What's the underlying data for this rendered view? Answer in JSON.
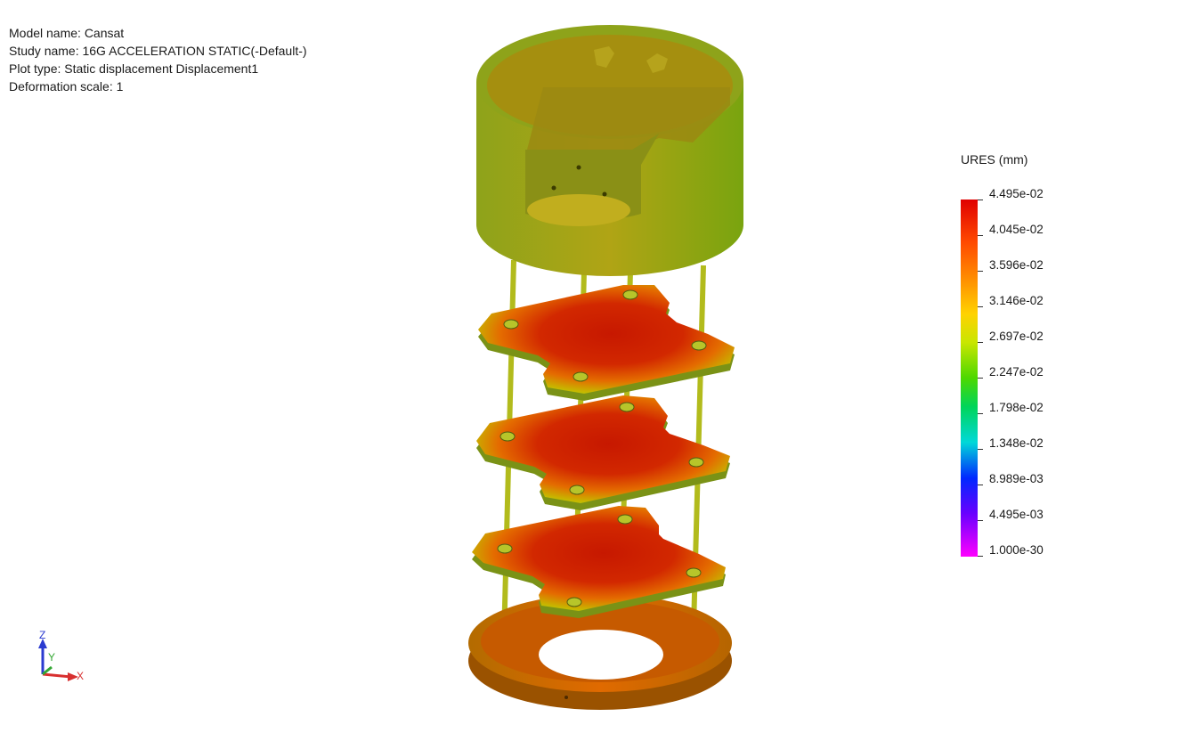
{
  "info": {
    "model_name": "Model name: Cansat",
    "study_name": "Study name: 16G ACCELERATION STATIC(-Default-)",
    "plot_type": "Plot type: Static displacement Displacement1",
    "deformation_scale": "Deformation scale: 1"
  },
  "legend": {
    "title": "URES (mm)",
    "labels": [
      "4.495e-02",
      "4.045e-02",
      "3.596e-02",
      "3.146e-02",
      "2.697e-02",
      "2.247e-02",
      "1.798e-02",
      "1.348e-02",
      "8.989e-03",
      "4.495e-03",
      "1.000e-30"
    ]
  },
  "triad": {
    "z": "Z",
    "y": "Y",
    "x": "X"
  },
  "colors": {
    "shell": "#97ab1c",
    "plate_hot": "#cc1f00",
    "plate_edge": "#a7c21f",
    "base": "#c46f00"
  }
}
